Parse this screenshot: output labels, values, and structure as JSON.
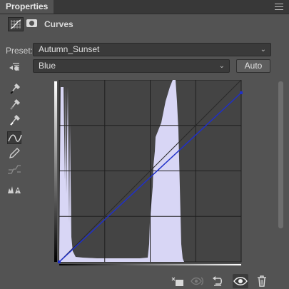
{
  "panel": {
    "tab_label": "Properties",
    "menu_icon": "hamburger-menu-icon"
  },
  "header": {
    "title": "Curves",
    "adjustment_icon": "curves-adjustment-icon",
    "mask_icon": "layer-mask-icon"
  },
  "preset": {
    "label": "Preset:",
    "value": "Autumn_Sunset"
  },
  "channel": {
    "value": "Blue",
    "auto_label": "Auto"
  },
  "tools": [
    {
      "name": "on-image-adjust-icon"
    },
    {
      "name": "black-point-eyedropper-icon"
    },
    {
      "name": "gray-point-eyedropper-icon"
    },
    {
      "name": "white-point-eyedropper-icon"
    },
    {
      "name": "edit-points-curve-icon",
      "active": true
    },
    {
      "name": "draw-pencil-icon"
    },
    {
      "name": "smooth-curve-icon"
    },
    {
      "name": "clipping-warning-icon"
    }
  ],
  "footer": {
    "icons": [
      "clip-to-layer-icon",
      "view-previous-state-icon",
      "reset-icon",
      "visibility-eye-icon",
      "trash-icon"
    ]
  },
  "curve": {
    "channel_color": "#1f2fc8",
    "points": [
      [
        0,
        0
      ],
      [
        255,
        230
      ]
    ],
    "histogram_color": "#d8d6f5"
  }
}
